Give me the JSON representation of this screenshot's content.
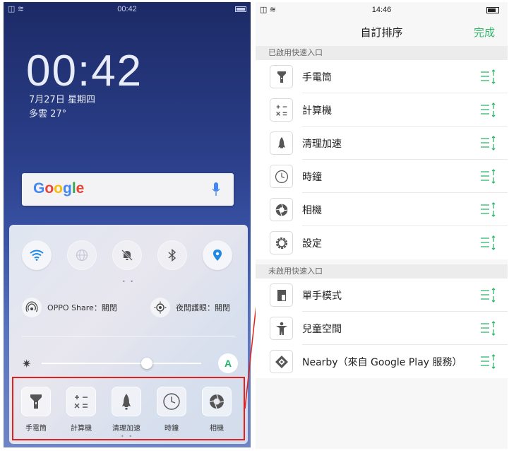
{
  "left_phone": {
    "status": {
      "time": "00:42"
    },
    "clock": "00:42",
    "date": "7月27日 星期四",
    "weather": "多雲 27°",
    "search": {
      "logo": [
        "G",
        "o",
        "o",
        "g",
        "l",
        "e"
      ]
    },
    "toggles": [
      {
        "icon": "wifi-icon",
        "state": "on"
      },
      {
        "icon": "globe-icon",
        "state": "off"
      },
      {
        "icon": "mute-bell-icon",
        "state": "off"
      },
      {
        "icon": "bluetooth-icon",
        "state": "off"
      },
      {
        "icon": "location-icon",
        "state": "on"
      }
    ],
    "page_dots_top": "• •",
    "oppo_share": "OPPO Share：關閉",
    "night_mode": "夜間護眼：關閉",
    "brightness": {
      "level": 0.66,
      "auto_label": "A"
    },
    "shortcuts": [
      {
        "label": "手電筒",
        "icon": "flashlight-icon"
      },
      {
        "label": "計算機",
        "icon": "calculator-icon"
      },
      {
        "label": "清理加速",
        "icon": "rocket-icon"
      },
      {
        "label": "時鐘",
        "icon": "clock-icon"
      },
      {
        "label": "相機",
        "icon": "camera-icon"
      }
    ],
    "page_dots_bottom": "• •"
  },
  "right_phone": {
    "status": {
      "time": "14:46"
    },
    "header": {
      "title": "自訂排序",
      "done": "完成"
    },
    "enabled_section": "已啟用快速入口",
    "enabled_items": [
      {
        "label": "手電筒",
        "icon": "flashlight-icon"
      },
      {
        "label": "計算機",
        "icon": "calculator-icon"
      },
      {
        "label": "清理加速",
        "icon": "rocket-icon"
      },
      {
        "label": "時鐘",
        "icon": "clock-icon"
      },
      {
        "label": "相機",
        "icon": "camera-icon"
      },
      {
        "label": "設定",
        "icon": "gear-icon"
      }
    ],
    "disabled_section": "未啟用快速入口",
    "disabled_items": [
      {
        "label": "單手模式",
        "icon": "one-hand-icon"
      },
      {
        "label": "兒童空間",
        "icon": "child-icon"
      },
      {
        "label": "Nearby（來自 Google Play 服務）",
        "icon": "nearby-icon"
      }
    ]
  },
  "colors": {
    "accent_green": "#2fb66b",
    "highlight_red": "#e0211d",
    "toggle_blue": "#1e88e5"
  }
}
